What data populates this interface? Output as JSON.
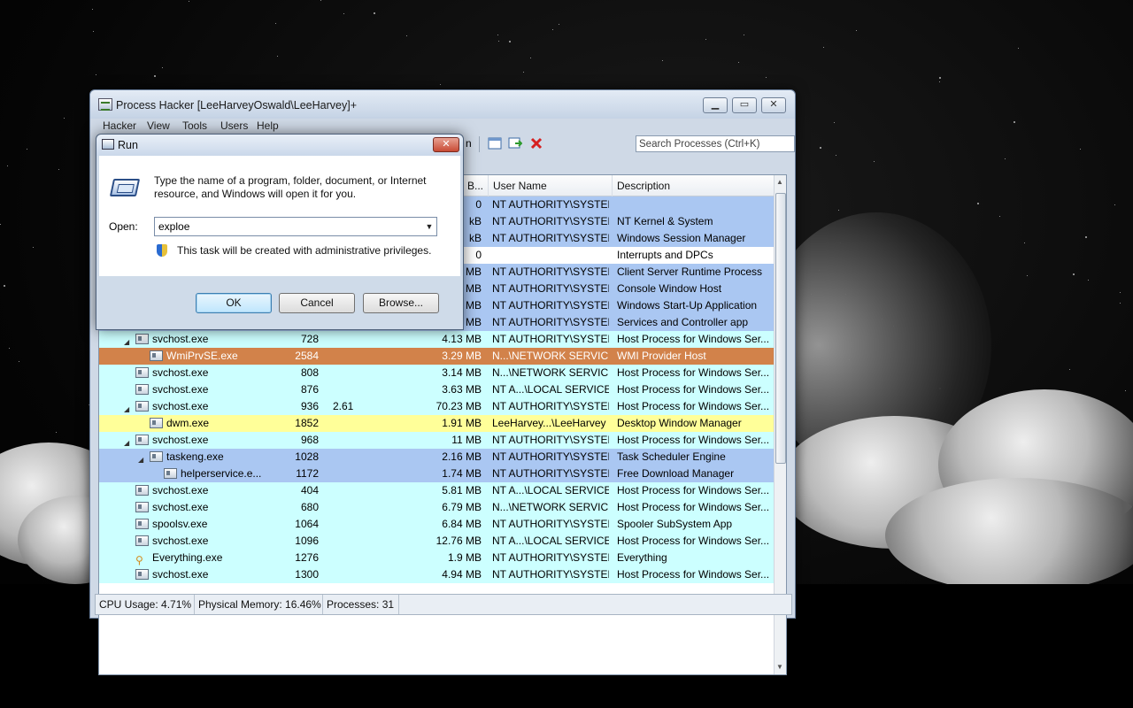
{
  "process_hacker": {
    "title": "Process Hacker [LeeHarveyOswald\\LeeHarvey]+",
    "menu": [
      "Hacker",
      "View",
      "Tools",
      "Users",
      "Help"
    ],
    "toolbar_partial_text": "n",
    "search_placeholder": "Search Processes (Ctrl+K)",
    "columns": {
      "bytes": "B...",
      "user_name": "User Name",
      "description": "Description"
    },
    "colors": {
      "service": "#ccffff",
      "system": "#aac7f2",
      "own": "#ffff99",
      "selected": "#d2824a",
      "normal": "#ffffff"
    },
    "rows": [
      {
        "name": "",
        "pid": "",
        "cpu": "",
        "mem": "0",
        "user": "NT AUTHORITY\\SYSTEM",
        "desc": "",
        "kind": "system",
        "indent": 0,
        "toggle": ""
      },
      {
        "name": "",
        "pid": "",
        "cpu": "",
        "mem": "kB",
        "user": "NT AUTHORITY\\SYSTEM",
        "desc": "NT Kernel & System",
        "kind": "system",
        "indent": 0,
        "toggle": ""
      },
      {
        "name": "",
        "pid": "",
        "cpu": "",
        "mem": "kB",
        "user": "NT AUTHORITY\\SYSTEM",
        "desc": "Windows Session Manager",
        "kind": "system",
        "indent": 0,
        "toggle": ""
      },
      {
        "name": "",
        "pid": "",
        "cpu": "",
        "mem": "0",
        "user": "",
        "desc": "Interrupts and DPCs",
        "kind": "normal",
        "indent": 0,
        "toggle": ""
      },
      {
        "name": "",
        "pid": "",
        "cpu": "",
        "mem": "MB",
        "user": "NT AUTHORITY\\SYSTEM",
        "desc": "Client Server Runtime Process",
        "kind": "system",
        "indent": 0,
        "toggle": ""
      },
      {
        "name": "",
        "pid": "",
        "cpu": "",
        "mem": "MB",
        "user": "NT AUTHORITY\\SYSTEM",
        "desc": "Console Window Host",
        "kind": "system",
        "indent": 0,
        "toggle": ""
      },
      {
        "name": "",
        "pid": "",
        "cpu": "",
        "mem": "MB",
        "user": "NT AUTHORITY\\SYSTEM",
        "desc": "Windows Start-Up Application",
        "kind": "system",
        "indent": 0,
        "toggle": ""
      },
      {
        "name": "",
        "pid": "",
        "cpu": "",
        "mem": "MB",
        "user": "NT AUTHORITY\\SYSTEM",
        "desc": "Services and Controller app",
        "kind": "system",
        "indent": 0,
        "toggle": ""
      },
      {
        "name": "svchost.exe",
        "pid": "728",
        "cpu": "",
        "mem": "4.13 MB",
        "user": "NT AUTHORITY\\SYSTEM",
        "desc": "Host Process for Windows Ser...",
        "kind": "service",
        "indent": 1,
        "toggle": "◢"
      },
      {
        "name": "WmiPrvSE.exe",
        "pid": "2584",
        "cpu": "",
        "mem": "3.29 MB",
        "user": "N...\\NETWORK SERVICE",
        "desc": "WMI Provider Host",
        "kind": "selected",
        "indent": 2,
        "toggle": ""
      },
      {
        "name": "svchost.exe",
        "pid": "808",
        "cpu": "",
        "mem": "3.14 MB",
        "user": "N...\\NETWORK SERVICE",
        "desc": "Host Process for Windows Ser...",
        "kind": "service",
        "indent": 1,
        "toggle": ""
      },
      {
        "name": "svchost.exe",
        "pid": "876",
        "cpu": "",
        "mem": "3.63 MB",
        "user": "NT A...\\LOCAL SERVICE",
        "desc": "Host Process for Windows Ser...",
        "kind": "service",
        "indent": 1,
        "toggle": ""
      },
      {
        "name": "svchost.exe",
        "pid": "936",
        "cpu": "2.61",
        "mem": "70.23 MB",
        "user": "NT AUTHORITY\\SYSTEM",
        "desc": "Host Process for Windows Ser...",
        "kind": "service",
        "indent": 1,
        "toggle": "◢"
      },
      {
        "name": "dwm.exe",
        "pid": "1852",
        "cpu": "",
        "mem": "1.91 MB",
        "user": "LeeHarvey...\\LeeHarvey",
        "desc": "Desktop Window Manager",
        "kind": "own",
        "indent": 2,
        "toggle": ""
      },
      {
        "name": "svchost.exe",
        "pid": "968",
        "cpu": "",
        "mem": "11 MB",
        "user": "NT AUTHORITY\\SYSTEM",
        "desc": "Host Process for Windows Ser...",
        "kind": "service",
        "indent": 1,
        "toggle": "◢"
      },
      {
        "name": "taskeng.exe",
        "pid": "1028",
        "cpu": "",
        "mem": "2.16 MB",
        "user": "NT AUTHORITY\\SYSTEM",
        "desc": "Task Scheduler Engine",
        "kind": "system",
        "indent": 2,
        "toggle": "◢"
      },
      {
        "name": "helperservice.e...",
        "pid": "1172",
        "cpu": "",
        "mem": "1.74 MB",
        "user": "NT AUTHORITY\\SYSTEM",
        "desc": "Free Download Manager",
        "kind": "system",
        "indent": 3,
        "toggle": ""
      },
      {
        "name": "svchost.exe",
        "pid": "404",
        "cpu": "",
        "mem": "5.81 MB",
        "user": "NT A...\\LOCAL SERVICE",
        "desc": "Host Process for Windows Ser...",
        "kind": "service",
        "indent": 1,
        "toggle": ""
      },
      {
        "name": "svchost.exe",
        "pid": "680",
        "cpu": "",
        "mem": "6.79 MB",
        "user": "N...\\NETWORK SERVICE",
        "desc": "Host Process for Windows Ser...",
        "kind": "service",
        "indent": 1,
        "toggle": ""
      },
      {
        "name": "spoolsv.exe",
        "pid": "1064",
        "cpu": "",
        "mem": "6.84 MB",
        "user": "NT AUTHORITY\\SYSTEM",
        "desc": "Spooler SubSystem App",
        "kind": "service",
        "indent": 1,
        "toggle": ""
      },
      {
        "name": "svchost.exe",
        "pid": "1096",
        "cpu": "",
        "mem": "12.76 MB",
        "user": "NT A...\\LOCAL SERVICE",
        "desc": "Host Process for Windows Ser...",
        "kind": "service",
        "indent": 1,
        "toggle": ""
      },
      {
        "name": "Everything.exe",
        "pid": "1276",
        "cpu": "",
        "mem": "1.9 MB",
        "user": "NT AUTHORITY\\SYSTEM",
        "desc": "Everything",
        "kind": "service",
        "indent": 1,
        "toggle": "",
        "icon": "magnifier"
      },
      {
        "name": "svchost.exe",
        "pid": "1300",
        "cpu": "",
        "mem": "4.94 MB",
        "user": "NT AUTHORITY\\SYSTEM",
        "desc": "Host Process for Windows Ser...",
        "kind": "service",
        "indent": 1,
        "toggle": ""
      }
    ],
    "status": {
      "cpu": "CPU Usage: 4.71%",
      "memory": "Physical Memory: 16.46%",
      "processes": "Processes: 31"
    }
  },
  "run_dialog": {
    "title": "Run",
    "description": "Type the name of a program, folder, document, or Internet resource, and Windows will open it for you.",
    "open_label": "Open:",
    "input_value": "exploe",
    "admin_note": "This task will be created with administrative privileges.",
    "ok_label": "OK",
    "cancel_label": "Cancel",
    "browse_label": "Browse..."
  }
}
